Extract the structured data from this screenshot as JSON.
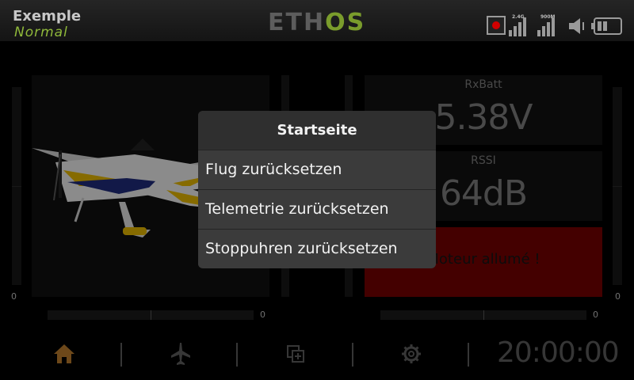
{
  "header": {
    "model_name": "Exemple",
    "flight_mode": "Normal",
    "brand_left": "ETH",
    "brand_right": "OS",
    "radio_band_1": "2.4G",
    "radio_band_2": "900M"
  },
  "left_panel": {
    "image": "airplane-model-image",
    "gauge_left_value": "0",
    "slider_value": "0"
  },
  "right_panel": {
    "widgets": [
      {
        "label": "RxBatt",
        "value": "5.38V"
      },
      {
        "label": "RSSI",
        "value": "64dB"
      }
    ],
    "alert": "Moteur allumé !",
    "gauge_right_value": "0",
    "slider_value": "0"
  },
  "bottom_nav": {
    "items": [
      "home-icon",
      "airplane-icon",
      "layers-icon",
      "gear-icon"
    ],
    "clock": "20:00:00"
  },
  "menu": {
    "title": "Startseite",
    "items": [
      "Flug zurücksetzen",
      "Telemetrie zurücksetzen",
      "Stoppuhren zurücksetzen"
    ]
  },
  "colors": {
    "accent_green": "#8fb83a",
    "home_icon": "#b6792c",
    "alert_red": "#720000",
    "record_red": "#d00000"
  }
}
